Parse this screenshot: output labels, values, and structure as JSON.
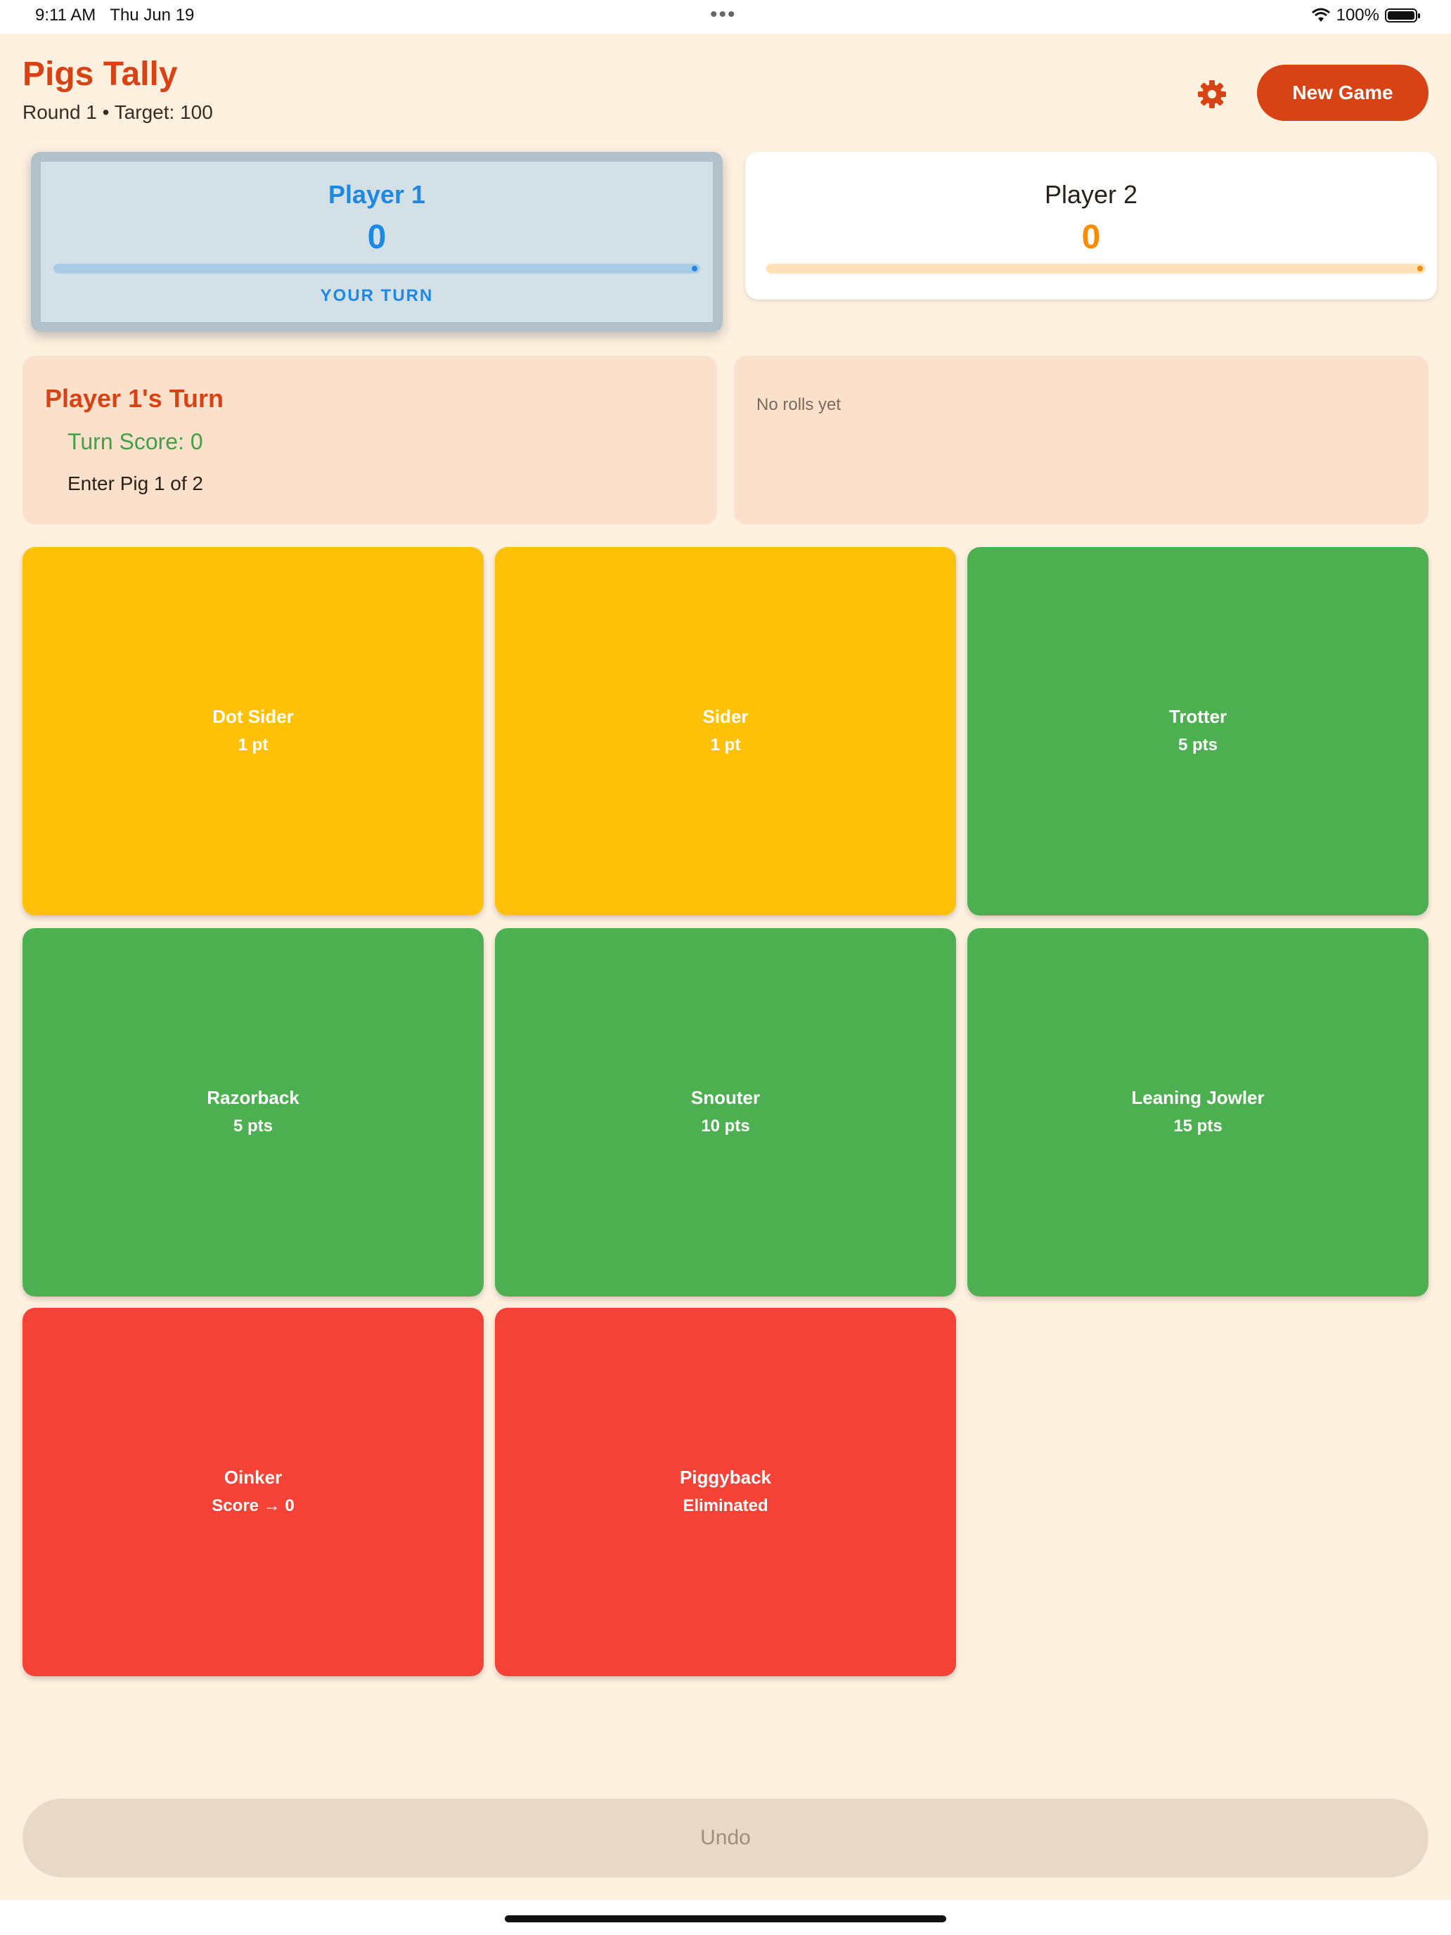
{
  "status_bar": {
    "time": "9:11 AM",
    "date": "Thu Jun 19",
    "battery": "100%"
  },
  "header": {
    "title": "Pigs Tally",
    "subtitle": "Round 1 • Target: 100",
    "settings_icon": "gear-icon",
    "new_game_label": "New Game"
  },
  "players": [
    {
      "name": "Player 1",
      "score": "0",
      "status": "YOUR TURN",
      "color": "#1e88e5",
      "active": true,
      "progress": 0
    },
    {
      "name": "Player 2",
      "score": "0",
      "color": "#fb8c00",
      "active": false,
      "progress": 0
    }
  ],
  "turn": {
    "title": "Player 1's Turn",
    "score_text": "Turn Score: 0",
    "hint": "Enter Pig 1 of 2"
  },
  "rolls": {
    "empty_text": "No rolls yet"
  },
  "positions": [
    {
      "name": "Dot Sider",
      "points": "1 pt",
      "color": "#ffc107"
    },
    {
      "name": "Sider",
      "points": "1 pt",
      "color": "#ffc107"
    },
    {
      "name": "Trotter",
      "points": "5 pts",
      "color": "#4caf50"
    },
    {
      "name": "Razorback",
      "points": "5 pts",
      "color": "#4caf50"
    },
    {
      "name": "Snouter",
      "points": "10 pts",
      "color": "#4caf50"
    },
    {
      "name": "Leaning Jowler",
      "points": "15 pts",
      "color": "#4caf50"
    },
    {
      "name": "Oinker",
      "points": "Score → 0",
      "color": "#f44336"
    },
    {
      "name": "Piggyback",
      "points": "Eliminated",
      "color": "#f44336"
    }
  ],
  "footer": {
    "undo_label": "Undo"
  },
  "colors": {
    "accent": "#d84315",
    "background": "#fff1e0",
    "panel": "#fbe0cc"
  }
}
